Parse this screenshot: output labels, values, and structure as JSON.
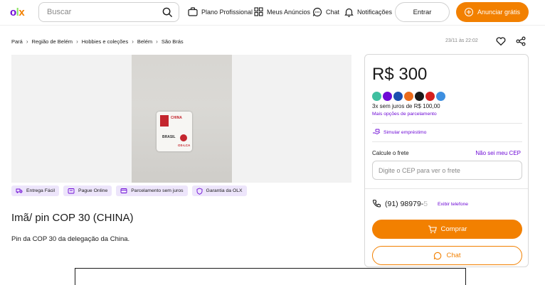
{
  "header": {
    "logo": {
      "o": "o",
      "l": "l",
      "x": "x"
    },
    "search_placeholder": "Buscar",
    "nav": [
      {
        "label": "Plano Profissional",
        "icon": "briefcase-icon"
      },
      {
        "label": "Meus Anúncios",
        "icon": "grid-icon"
      },
      {
        "label": "Chat",
        "icon": "chat-icon"
      },
      {
        "label": "Notificações",
        "icon": "bell-icon"
      }
    ],
    "login_label": "Entrar",
    "publish_label": "Anunciar grátis"
  },
  "breadcrumb": [
    "Pará",
    "Região de Belém",
    "Hobbies e coleções",
    "Belém",
    "São Brás"
  ],
  "posted_date": "23/11 às 22:02",
  "badges": [
    {
      "label": "Entrega Fácil",
      "icon": "truck-icon"
    },
    {
      "label": "Pague Online",
      "icon": "wallet-icon"
    },
    {
      "label": "Parcelamento sem juros",
      "icon": "card-icon"
    },
    {
      "label": "Garantia da OLX",
      "icon": "shield-icon"
    }
  ],
  "product": {
    "title": "Imã/ pin COP 30 (CHINA)",
    "description": "Pin da COP 30 da delegação da China."
  },
  "pin_image": {
    "top_text": "CHINA",
    "middle_text": "BRASIL",
    "bottom_text": "OS-LCA"
  },
  "offer": {
    "price": "R$ 300",
    "installments": "3x sem juros de R$ 100,00",
    "more_installments": "Mais opções de parcelamento",
    "loan_link": "Simular empréstimo",
    "shipping_label": "Calcule o frete",
    "cep_help": "Não sei meu CEP",
    "cep_placeholder": "Digite o CEP para ver o frete",
    "phone_visible": "(91) 98979-",
    "phone_faded": "5",
    "show_phone": "Exibir telefone",
    "buy_label": "Comprar",
    "chat_label": "Chat"
  },
  "payment_colors": [
    "#3fbfa0",
    "#6e0ad6",
    "#1a4fb0",
    "#eb6b1b",
    "#1a1a1a",
    "#d6201f",
    "#3d8fe0"
  ],
  "colors": {
    "accent": "#f28000",
    "purple": "#6e0ad6"
  }
}
